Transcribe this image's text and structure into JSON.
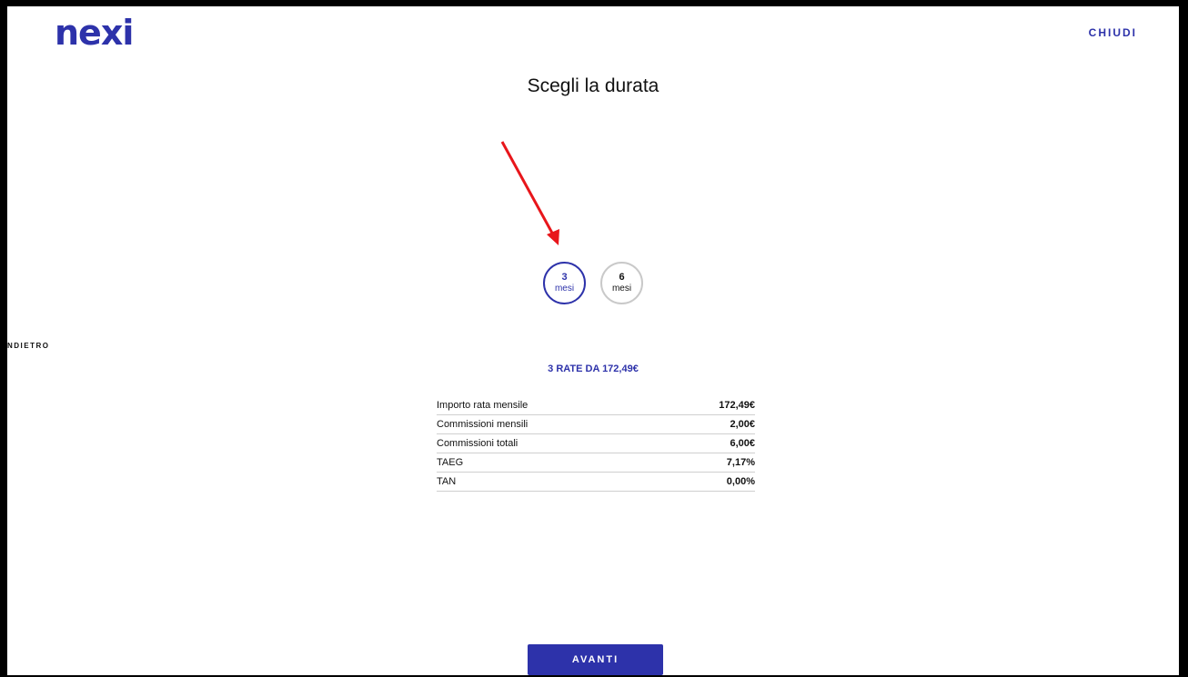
{
  "header": {
    "logo_text": "nexi",
    "close_label": "CHIUDI"
  },
  "page": {
    "title": "Scegli la durata"
  },
  "duration_options": [
    {
      "number": "3",
      "unit": "mesi",
      "selected": true
    },
    {
      "number": "6",
      "unit": "mesi",
      "selected": false
    }
  ],
  "nav": {
    "back_label": "NDIETRO"
  },
  "summary": {
    "text": "3 RATE DA 172,49€"
  },
  "details": [
    {
      "label": "Importo rata mensile",
      "value": "172,49€"
    },
    {
      "label": "Commissioni mensili",
      "value": "2,00€"
    },
    {
      "label": "Commissioni totali",
      "value": "6,00€"
    },
    {
      "label": "TAEG",
      "value": "7,17%"
    },
    {
      "label": "TAN",
      "value": "0,00%"
    }
  ],
  "cta": {
    "label": "AVANTI"
  },
  "colors": {
    "brand": "#2d32aa",
    "annotation_arrow": "#e8161b",
    "chip_border": "#c9c9c9"
  }
}
